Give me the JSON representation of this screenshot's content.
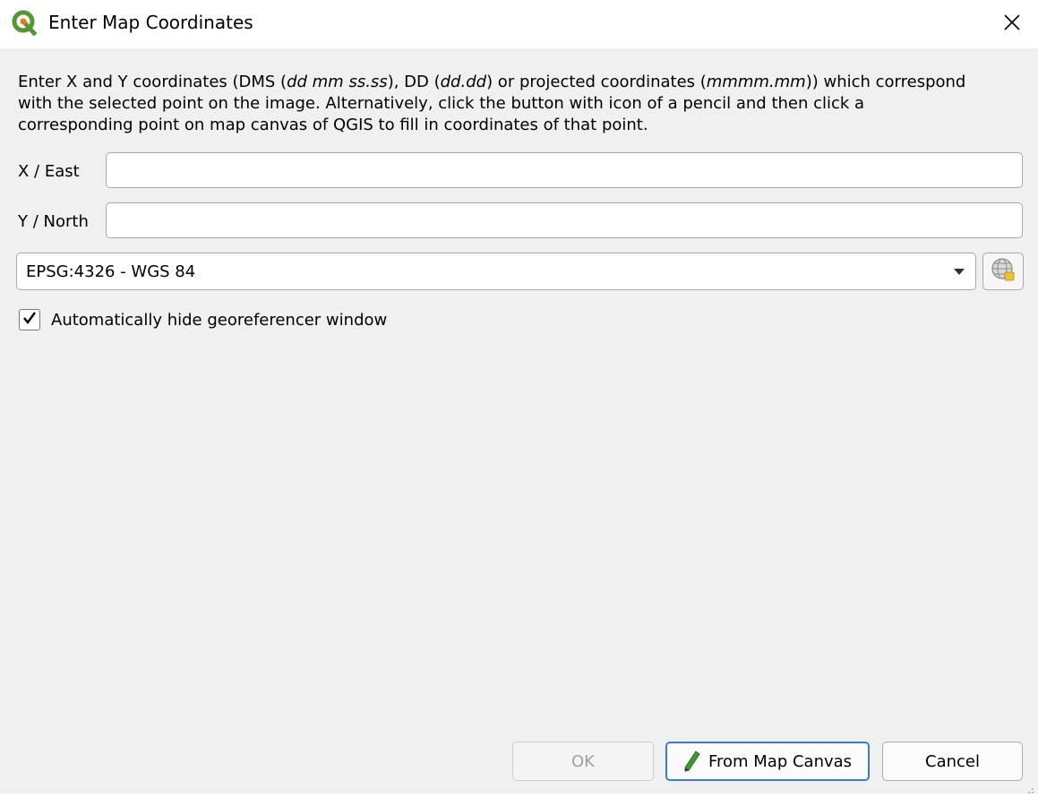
{
  "window": {
    "title": "Enter Map Coordinates"
  },
  "description": {
    "p1": "Enter X and Y coordinates (DMS (",
    "p1_italic": "dd mm ss.ss",
    "p2": "), DD (",
    "p2_italic": "dd.dd",
    "p3": ") or projected coordinates (",
    "p3_italic": "mmmm.mm",
    "p4": ")) which correspond\nwith the selected point on the image. Alternatively, click the button with icon of a pencil and then click a\ncorresponding point on map canvas of QGIS to fill in coordinates of that point."
  },
  "form": {
    "x_label": "X / East",
    "x_value": "",
    "y_label": "Y / North",
    "y_value": "",
    "crs_selected": "EPSG:4326 - WGS 84",
    "auto_hide_checked": true,
    "auto_hide_label": "Automatically hide georeferencer window"
  },
  "buttons": {
    "ok": "OK",
    "from_map_canvas": "From Map Canvas",
    "cancel": "Cancel"
  },
  "icons": {
    "app": "qgis-logo-icon",
    "close": "close-icon",
    "dropdown": "chevron-down-icon",
    "crs": "globe-crs-icon",
    "pencil": "pencil-icon",
    "check": "checkmark-icon"
  },
  "colors": {
    "window_bg": "#f0f0f0",
    "titlebar_bg": "#ffffff",
    "focus_border": "#3a7bd5",
    "pencil_green": "#3c9a2e"
  }
}
